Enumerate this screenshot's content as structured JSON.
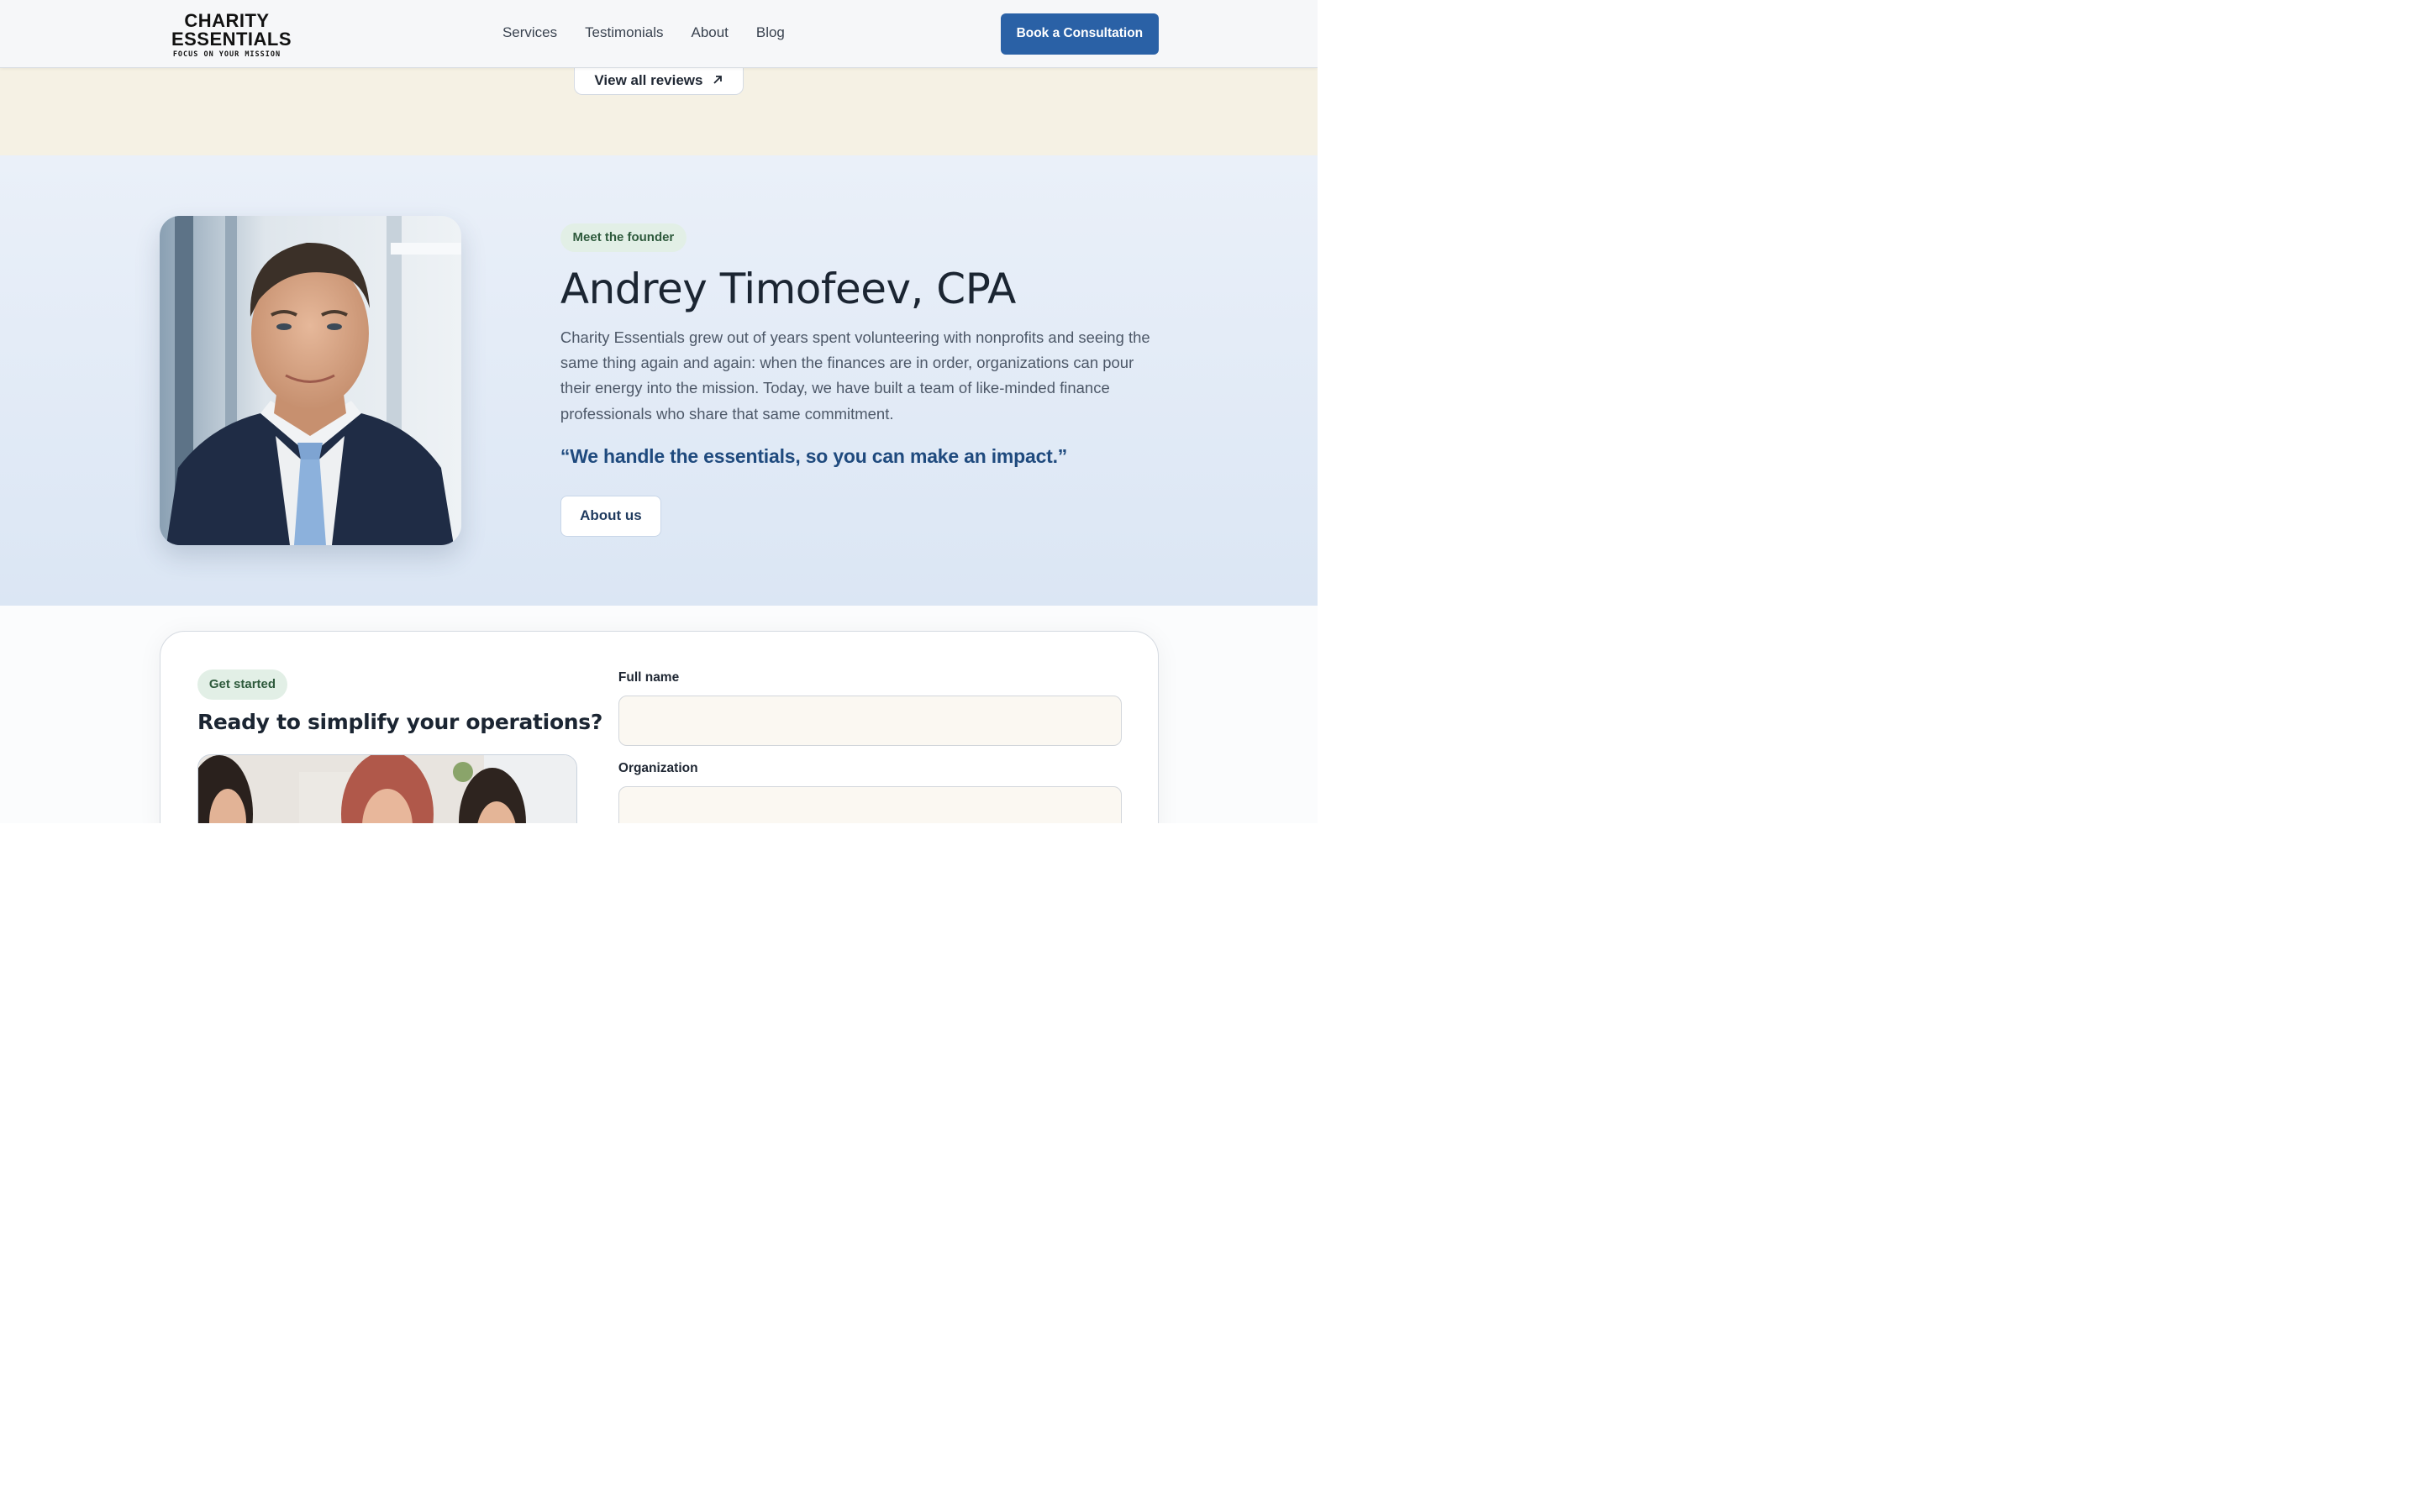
{
  "header": {
    "logo_line1": "CHARITY",
    "logo_line2": "ESSENTIALS",
    "logo_tagline": "FOCUS ON YOUR MISSION",
    "nav": [
      "Services",
      "Testimonials",
      "About",
      "Blog"
    ],
    "cta_label": "Book a Consultation"
  },
  "reviews": {
    "button_label": "View all reviews",
    "button_icon": "arrow-up-right-icon"
  },
  "founder": {
    "badge": "Meet the founder",
    "name": "Andrey Timofeev, CPA",
    "bio": "Charity Essentials grew out of years spent volunteering with nonprofits and seeing the same thing again and again: when the finances are in order, organizations can pour their energy into the mission. Today, we have built a team of like-minded finance professionals who share that same commitment.",
    "quote": "“We handle the essentials, so you can make an impact.”",
    "button_label": "About us"
  },
  "get_started": {
    "badge": "Get started",
    "title": "Ready to simplify your operations?",
    "fields": [
      {
        "label": "Full name",
        "value": ""
      },
      {
        "label": "Organization",
        "value": ""
      }
    ]
  },
  "colors": {
    "primary": "#2a61a6",
    "quote": "#1f4a7e",
    "badge_bg": "#e2efe6",
    "badge_text": "#2e5a3c",
    "reviews_bg": "#f5f1e4",
    "founder_bg": "#e3ebf7"
  }
}
